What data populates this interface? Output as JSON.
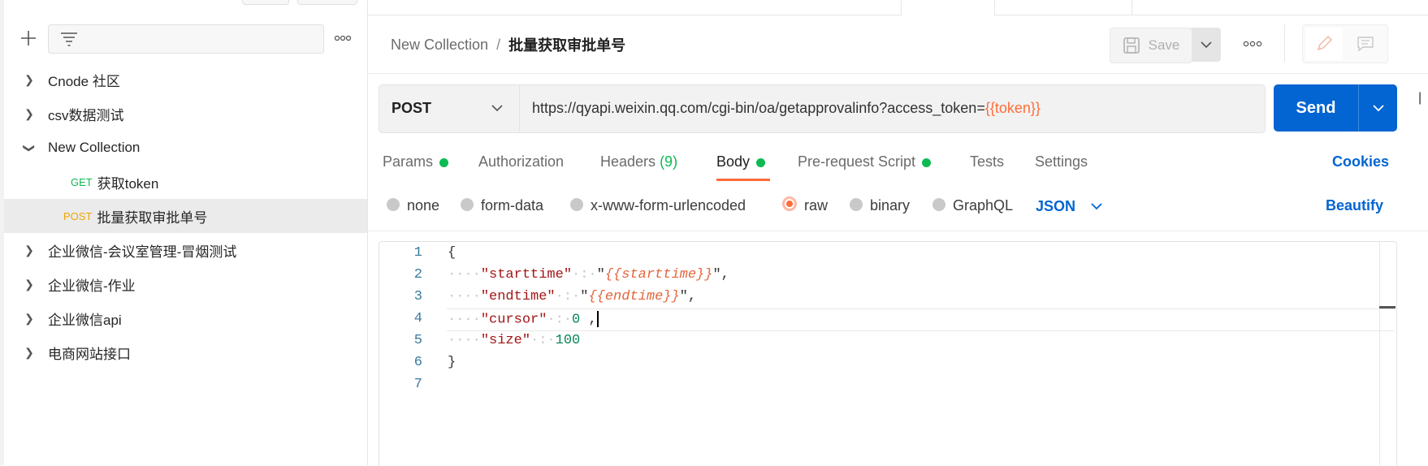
{
  "sidebar": {
    "items": [
      {
        "label": "Cnode 社区",
        "expanded": false
      },
      {
        "label": "csv数据测试",
        "expanded": false
      },
      {
        "label": "New Collection",
        "expanded": true
      },
      {
        "method": "GET",
        "label": "获取token",
        "child": true
      },
      {
        "method": "POST",
        "label": "批量获取审批单号",
        "child": true,
        "selected": true
      },
      {
        "label": "企业微信-会议室管理-冒烟测试",
        "expanded": false
      },
      {
        "label": "企业微信-作业",
        "expanded": false
      },
      {
        "label": "企业微信api",
        "expanded": false
      },
      {
        "label": "电商网站接口",
        "expanded": false
      }
    ],
    "add_icon": "plus-icon",
    "filter_icon": "filter-icon",
    "more_icon": "ellipsis-icon"
  },
  "header": {
    "collection": "New Collection",
    "separator": "/",
    "request_name": "批量获取审批单号",
    "save_label": "Save"
  },
  "request": {
    "method": "POST",
    "url_prefix": "https://qyapi.weixin.qq.com/cgi-bin/oa/getapprovalinfo?access_token=",
    "url_variable": "{{token}}",
    "send_label": "Send"
  },
  "tabs": {
    "params": "Params",
    "authorization": "Authorization",
    "headers": "Headers",
    "headers_count": "(9)",
    "body": "Body",
    "prerequest": "Pre-request Script",
    "tests": "Tests",
    "settings": "Settings",
    "cookies": "Cookies"
  },
  "body_types": {
    "none": "none",
    "form_data": "form-data",
    "urlencoded": "x-www-form-urlencoded",
    "raw": "raw",
    "binary": "binary",
    "graphql": "GraphQL",
    "format": "JSON",
    "beautify": "Beautify",
    "selected": "raw"
  },
  "editor": {
    "line_numbers": [
      "1",
      "2",
      "3",
      "4",
      "5",
      "6",
      "7"
    ],
    "l1": "{",
    "l2_key": "\"starttime\"",
    "l2_open": "\"",
    "l2_var": "{{starttime}}",
    "l2_close": "\",",
    "l3_key": "\"endtime\"",
    "l3_open": "\"",
    "l3_var": "{{endtime}}",
    "l3_close": "\",",
    "l4_key": "\"cursor\"",
    "l4_val": "0",
    "l4_end": ",",
    "l5_key": "\"size\"",
    "l5_val": "100",
    "l6": "}",
    "indent": "····",
    "colon": "·:·"
  },
  "colors": {
    "accent": "#0265d2",
    "orange": "#ff6c37",
    "green": "#0cbb52"
  }
}
